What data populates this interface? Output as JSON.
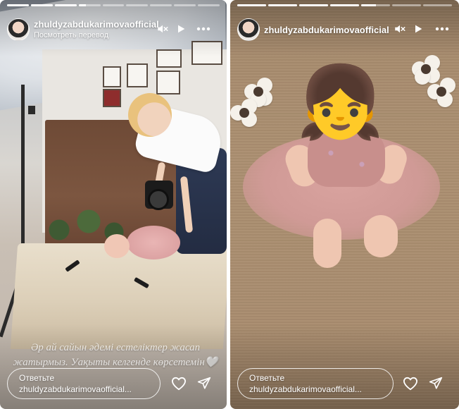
{
  "stories": [
    {
      "progress": [
        1,
        1,
        1,
        0.35,
        0,
        0,
        0,
        0,
        0
      ],
      "username": "zhuldyzabdukarimovaofficial",
      "translate_label": "Посмотреть перевод",
      "caption": "Әр ай сайын әдемі естеліктер жасап жатырмыз. Уақыты келгенде көрсетемін🤍",
      "reply_placeholder_line1": "Ответьте",
      "reply_placeholder_line2": "zhuldyzabdukarimovaofficial..."
    },
    {
      "progress": [
        1,
        1,
        1,
        1,
        0.5,
        0,
        0
      ],
      "username": "zhuldyzabdukarimovaofficial",
      "emoji": "👧",
      "reply_placeholder_line1": "Ответьте",
      "reply_placeholder_line2": "zhuldyzabdukarimovaofficial..."
    }
  ],
  "icons": {
    "mute": "muted-speaker-icon",
    "play": "play-icon",
    "more": "more-options-icon",
    "like": "heart-icon",
    "share": "paper-plane-icon"
  },
  "colors": {
    "overlay_text": "#ffffff",
    "page_bg": "#ffffff"
  }
}
